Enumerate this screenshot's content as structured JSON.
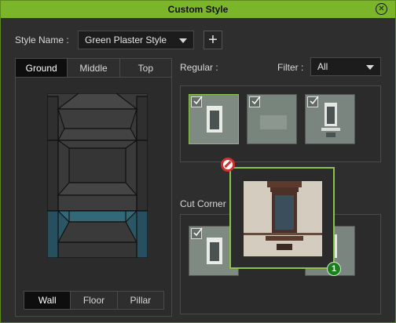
{
  "window": {
    "title": "Custom Style",
    "accent": "#7bb52a"
  },
  "style_name": {
    "label": "Style Name :",
    "value": "Green Plaster Style"
  },
  "add_button": {
    "label": "+"
  },
  "level_tabs": [
    {
      "label": "Ground",
      "active": true
    },
    {
      "label": "Middle",
      "active": false
    },
    {
      "label": "Top",
      "active": false
    }
  ],
  "part_tabs": [
    {
      "label": "Wall",
      "active": true
    },
    {
      "label": "Floor",
      "active": false
    },
    {
      "label": "Pillar",
      "active": false
    }
  ],
  "regular": {
    "label": "Regular :",
    "filter_label": "Filter :",
    "filter_value": "All"
  },
  "cut_corner": {
    "label": "Cut Corner"
  },
  "drag_badge": {
    "count": "1"
  }
}
